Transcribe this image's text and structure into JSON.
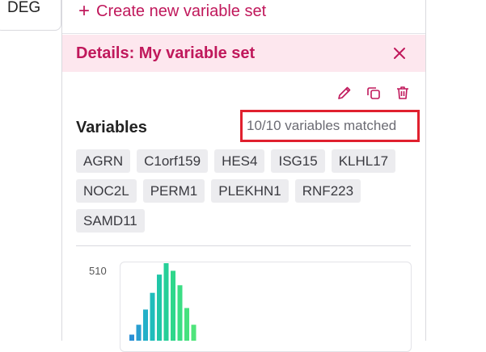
{
  "left_tab": {
    "label": "DEG"
  },
  "panel": {
    "create_label": "Create new variable set",
    "details_title": "Details: My variable set",
    "variables_title": "Variables",
    "matched_text": "10/10 variables matched",
    "variables": [
      "AGRN",
      "C1orf159",
      "HES4",
      "ISG15",
      "KLHL17",
      "NOC2L",
      "PERM1",
      "PLEKHN1",
      "RNF223",
      "SAMD11"
    ]
  },
  "icons": {
    "create": "plus-icon",
    "close": "close-icon",
    "edit": "pencil-icon",
    "duplicate": "copy-icon",
    "delete": "trash-icon"
  },
  "colors": {
    "accent": "#c0185b",
    "header_bg": "#fde7ee",
    "highlight": "#e0202e"
  },
  "chart_data": {
    "type": "bar",
    "y_tick": "510",
    "values": [
      40,
      105,
      205,
      315,
      435,
      510,
      460,
      365,
      215,
      105
    ]
  }
}
